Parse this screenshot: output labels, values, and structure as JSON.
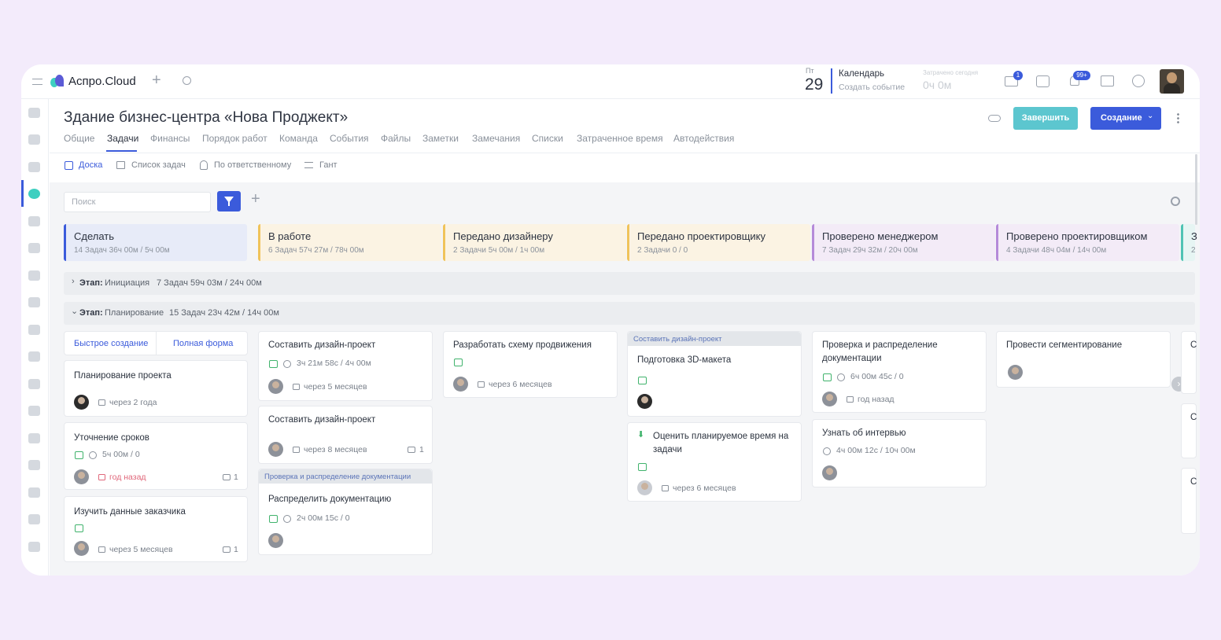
{
  "app": {
    "name": "Аспро.Cloud"
  },
  "topbar": {
    "date_day": "Пт",
    "date_num": "29",
    "calendar_title": "Календарь",
    "calendar_action": "Создать событие",
    "spent_label": "Затрачено сегодня",
    "spent_value": "0ч 0м",
    "mail_badge": "1",
    "notif_badge": "99+"
  },
  "project": {
    "title": "Здание бизнес-центра «Нова Проджект»",
    "finish_button": "Завершить",
    "create_button": "Создание",
    "tabs": [
      "Общие",
      "Задачи",
      "Финансы",
      "Порядок работ",
      "Команда",
      "События",
      "Файлы",
      "Заметки",
      "Замечания",
      "Списки",
      "Затраченное время",
      "Автодействия"
    ],
    "active_tab": "Задачи"
  },
  "views": [
    "Доска",
    "Список задач",
    "По ответственному",
    "Гант"
  ],
  "search": {
    "placeholder": "Поиск"
  },
  "columns": [
    {
      "title": "Сделать",
      "stats": "14 Задач   36ч 00м / 5ч 00м",
      "color": "#3b5bdb",
      "bg": "#e7ebf8"
    },
    {
      "title": "В работе",
      "stats": "6 Задач   57ч 27м / 78ч 00м",
      "color": "#f0c35a",
      "bg": "#fbf3e3"
    },
    {
      "title": "Передано дизайнеру",
      "stats": "2 Задачи   5ч 00м / 1ч 00м",
      "color": "#f0c35a",
      "bg": "#fbf3e3"
    },
    {
      "title": "Передано проектировщику",
      "stats": "2 Задачи   0 / 0",
      "color": "#f0c35a",
      "bg": "#fbf3e3"
    },
    {
      "title": "Проверено менеджером",
      "stats": "7 Задач   29ч 32м / 20ч 00м",
      "color": "#b58ad9",
      "bg": "#f3ebf7"
    },
    {
      "title": "Проверено проектировщиком",
      "stats": "4 Задачи   48ч 04м / 14ч 00м",
      "color": "#b58ad9",
      "bg": "#f3ebf7"
    },
    {
      "title": "З",
      "stats": "2",
      "color": "#4fc3b4",
      "bg": "#e6f5f3"
    }
  ],
  "stages": [
    {
      "label": "Этап:",
      "name": "Инициация",
      "stats": "7 Задач 59ч 03м / 24ч 00м"
    },
    {
      "label": "Этап:",
      "name": "Планирование",
      "stats": "15 Задач 23ч 42м / 14ч 00м"
    }
  ],
  "quick_create": {
    "fast": "Быстрое создание",
    "full": "Полная форма"
  },
  "cards": {
    "c1": {
      "title": "Планирование проекта",
      "due": "через 2 года"
    },
    "c2": {
      "title": "Уточнение сроков",
      "time": "5ч 00м   / 0",
      "due": "год назад",
      "comments": "1"
    },
    "c3": {
      "title": "Изучить данные заказчика",
      "due": "через 5 месяцев",
      "comments": "1"
    },
    "c4": {
      "title": "Составить дизайн-проект",
      "time": "3ч 21м 58с / 4ч 00м",
      "due": "через 5 месяцев"
    },
    "c5": {
      "title": "Составить дизайн-проект",
      "due": "через 8 месяцев",
      "comments": "1"
    },
    "c6": {
      "parent": "Проверка и распределение документации",
      "title": "Распределить документацию",
      "time": "2ч 00м 15с / 0"
    },
    "c7": {
      "title": "Разработать схему продвижения",
      "due": "через 6 месяцев"
    },
    "c8": {
      "parent": "Составить дизайн-проект",
      "title": "Подготовка 3D-макета"
    },
    "c9": {
      "title": "Оценить планируемое время на задачи",
      "due": "через 6 месяцев"
    },
    "c10": {
      "title": "Проверка и распределение документации",
      "time": "6ч 00м 45с / 0",
      "due": "год назад"
    },
    "c11": {
      "title": "Узнать об интервью",
      "time": "4ч 00м 12с / 10ч 00м"
    },
    "c12": {
      "title": "Провести сегментирование"
    },
    "c13": {
      "title": "С"
    },
    "c14": {
      "title": "С"
    },
    "c15": {
      "title": "С"
    }
  }
}
